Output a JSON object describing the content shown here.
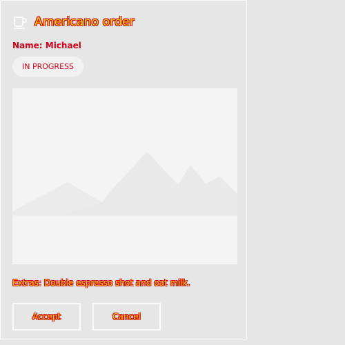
{
  "card": {
    "title": "Americano order",
    "name_line": "Name: Michael",
    "status": "IN PROGRESS",
    "description": "Extras: Double espresso shot and oat milk.",
    "accept_label": "Accept",
    "cancel_label": "Cancel"
  },
  "icons": {
    "header": "coffee-cup-icon",
    "image": "image-placeholder"
  },
  "colors": {
    "text_fill": "#f5d800",
    "text_stroke": "#d0021b",
    "background": "#e6e6e6",
    "card_border": "#fafafa",
    "placeholder_bg": "#f4f4f4",
    "badge_bg": "#f2f2f2"
  }
}
